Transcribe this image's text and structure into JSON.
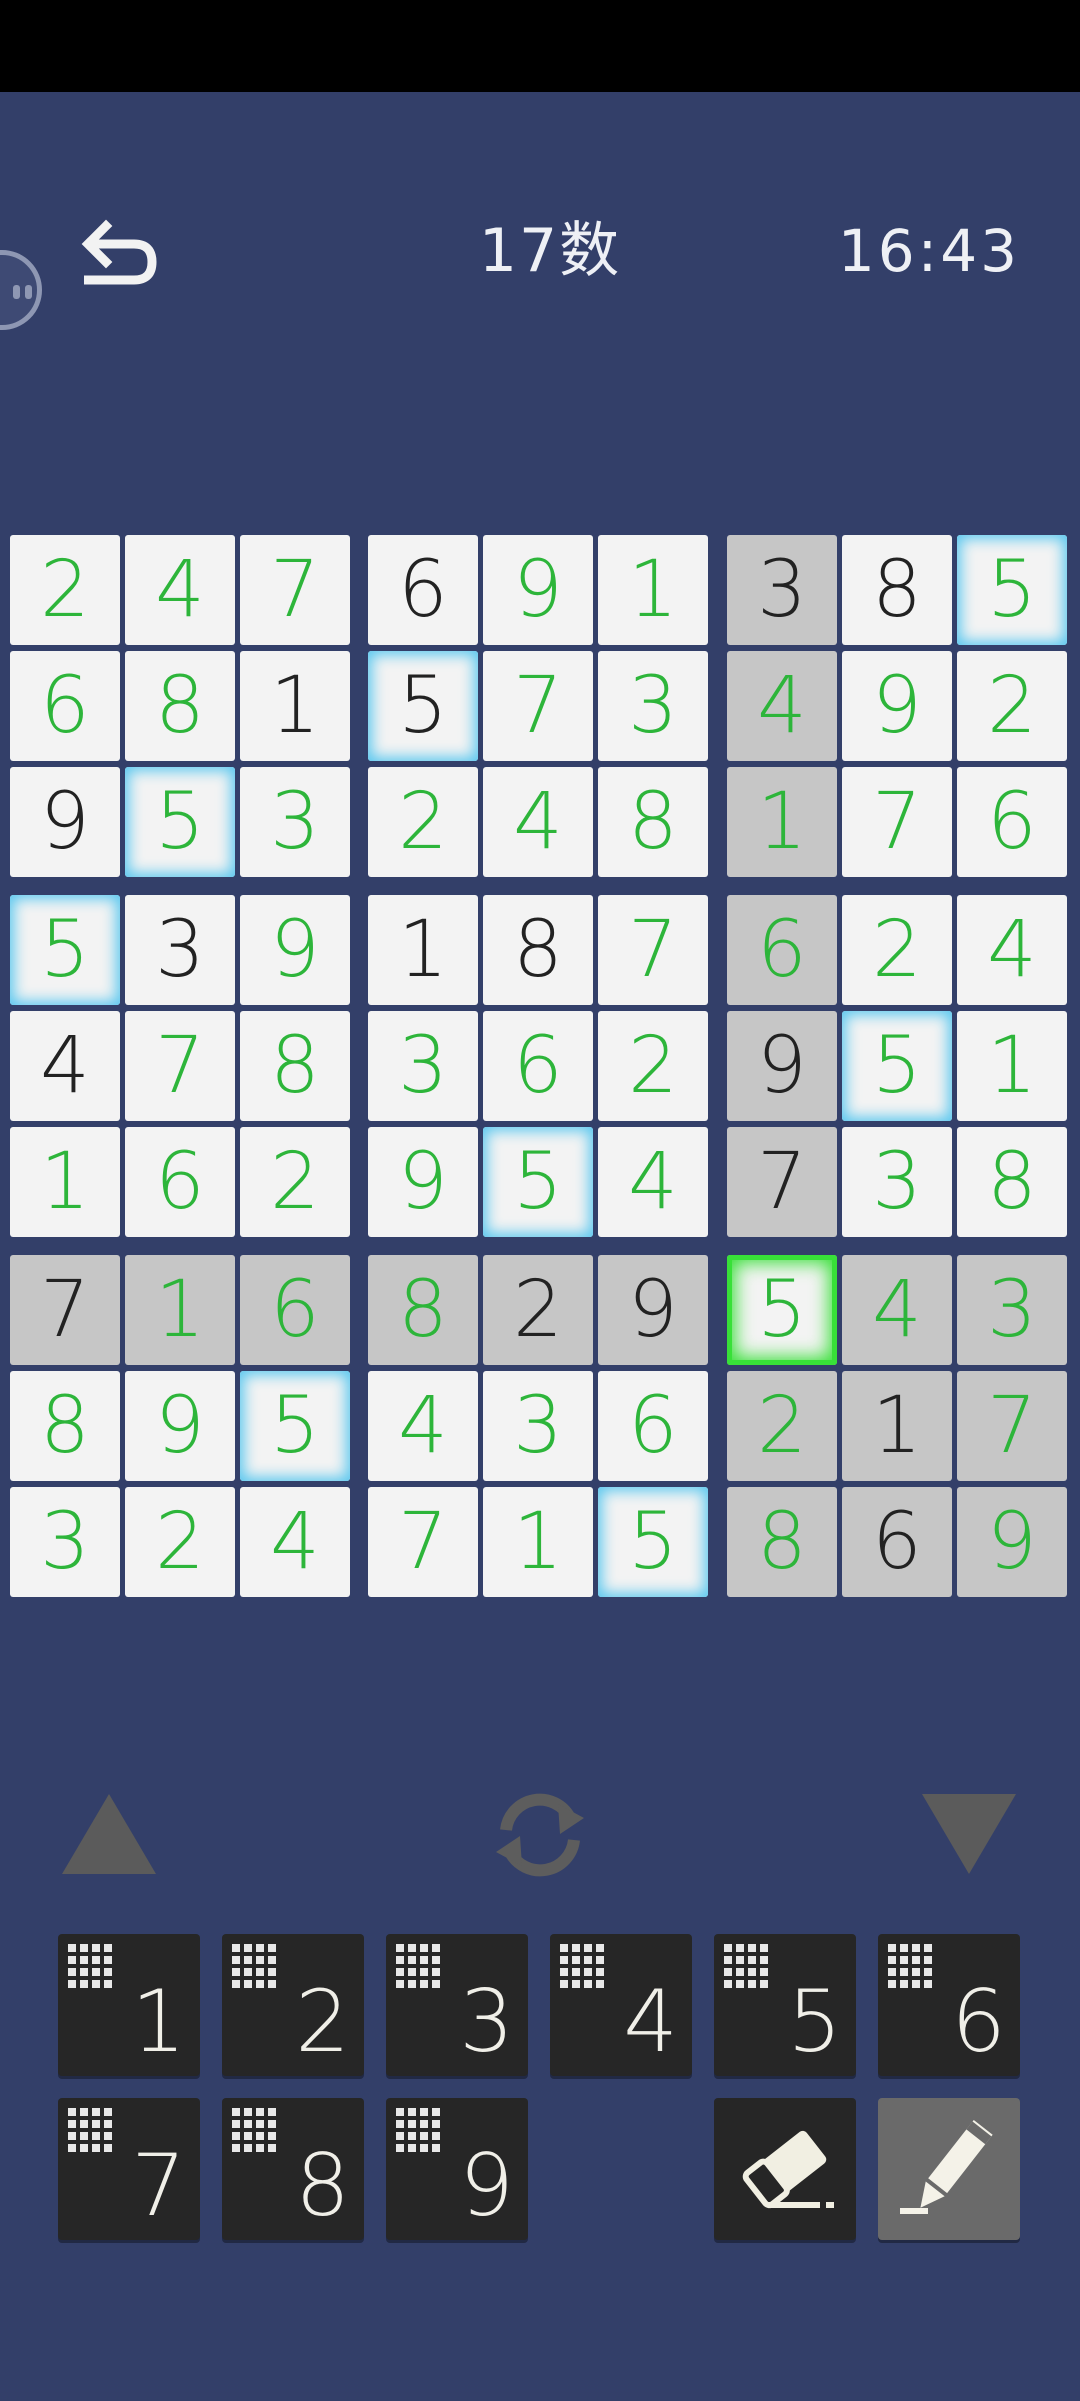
{
  "header": {
    "title": "17数",
    "timer": "16:43"
  },
  "icons": {
    "undo": "undo-arrow-icon",
    "refresh": "refresh-icon",
    "up": "triangle-up-icon",
    "down": "triangle-down-icon",
    "eraser": "eraser-icon",
    "pencil": "pencil-icon",
    "notes": "notes-grid-icon"
  },
  "colors": {
    "background": "#333f69",
    "given_digit": "#222222",
    "entered_digit": "#2db53a",
    "same_number_glow": "#5cc8ef",
    "selected_glow": "#38e038",
    "cell_light": "#f3f3f3",
    "cell_gray": "#c6c6c6"
  },
  "board": {
    "rows": [
      [
        {
          "v": "2",
          "given": false,
          "gray": false,
          "hl": ""
        },
        {
          "v": "4",
          "given": false,
          "gray": false,
          "hl": ""
        },
        {
          "v": "7",
          "given": false,
          "gray": false,
          "hl": ""
        },
        {
          "v": "6",
          "given": true,
          "gray": false,
          "hl": ""
        },
        {
          "v": "9",
          "given": false,
          "gray": false,
          "hl": ""
        },
        {
          "v": "1",
          "given": false,
          "gray": false,
          "hl": ""
        },
        {
          "v": "3",
          "given": true,
          "gray": true,
          "hl": ""
        },
        {
          "v": "8",
          "given": true,
          "gray": false,
          "hl": ""
        },
        {
          "v": "5",
          "given": false,
          "gray": false,
          "hl": "same"
        }
      ],
      [
        {
          "v": "6",
          "given": false,
          "gray": false,
          "hl": ""
        },
        {
          "v": "8",
          "given": false,
          "gray": false,
          "hl": ""
        },
        {
          "v": "1",
          "given": true,
          "gray": false,
          "hl": ""
        },
        {
          "v": "5",
          "given": true,
          "gray": false,
          "hl": "same"
        },
        {
          "v": "7",
          "given": false,
          "gray": false,
          "hl": ""
        },
        {
          "v": "3",
          "given": false,
          "gray": false,
          "hl": ""
        },
        {
          "v": "4",
          "given": false,
          "gray": true,
          "hl": ""
        },
        {
          "v": "9",
          "given": false,
          "gray": false,
          "hl": ""
        },
        {
          "v": "2",
          "given": false,
          "gray": false,
          "hl": ""
        }
      ],
      [
        {
          "v": "9",
          "given": true,
          "gray": false,
          "hl": ""
        },
        {
          "v": "5",
          "given": false,
          "gray": false,
          "hl": "same"
        },
        {
          "v": "3",
          "given": false,
          "gray": false,
          "hl": ""
        },
        {
          "v": "2",
          "given": false,
          "gray": false,
          "hl": ""
        },
        {
          "v": "4",
          "given": false,
          "gray": false,
          "hl": ""
        },
        {
          "v": "8",
          "given": false,
          "gray": false,
          "hl": ""
        },
        {
          "v": "1",
          "given": false,
          "gray": true,
          "hl": ""
        },
        {
          "v": "7",
          "given": false,
          "gray": false,
          "hl": ""
        },
        {
          "v": "6",
          "given": false,
          "gray": false,
          "hl": ""
        }
      ],
      [
        {
          "v": "5",
          "given": false,
          "gray": false,
          "hl": "same"
        },
        {
          "v": "3",
          "given": true,
          "gray": false,
          "hl": ""
        },
        {
          "v": "9",
          "given": false,
          "gray": false,
          "hl": ""
        },
        {
          "v": "1",
          "given": true,
          "gray": false,
          "hl": ""
        },
        {
          "v": "8",
          "given": true,
          "gray": false,
          "hl": ""
        },
        {
          "v": "7",
          "given": false,
          "gray": false,
          "hl": ""
        },
        {
          "v": "6",
          "given": false,
          "gray": true,
          "hl": ""
        },
        {
          "v": "2",
          "given": false,
          "gray": false,
          "hl": ""
        },
        {
          "v": "4",
          "given": false,
          "gray": false,
          "hl": ""
        }
      ],
      [
        {
          "v": "4",
          "given": true,
          "gray": false,
          "hl": ""
        },
        {
          "v": "7",
          "given": false,
          "gray": false,
          "hl": ""
        },
        {
          "v": "8",
          "given": false,
          "gray": false,
          "hl": ""
        },
        {
          "v": "3",
          "given": false,
          "gray": false,
          "hl": ""
        },
        {
          "v": "6",
          "given": false,
          "gray": false,
          "hl": ""
        },
        {
          "v": "2",
          "given": false,
          "gray": false,
          "hl": ""
        },
        {
          "v": "9",
          "given": true,
          "gray": true,
          "hl": ""
        },
        {
          "v": "5",
          "given": false,
          "gray": false,
          "hl": "same"
        },
        {
          "v": "1",
          "given": false,
          "gray": false,
          "hl": ""
        }
      ],
      [
        {
          "v": "1",
          "given": false,
          "gray": false,
          "hl": ""
        },
        {
          "v": "6",
          "given": false,
          "gray": false,
          "hl": ""
        },
        {
          "v": "2",
          "given": false,
          "gray": false,
          "hl": ""
        },
        {
          "v": "9",
          "given": false,
          "gray": false,
          "hl": ""
        },
        {
          "v": "5",
          "given": false,
          "gray": false,
          "hl": "same"
        },
        {
          "v": "4",
          "given": false,
          "gray": false,
          "hl": ""
        },
        {
          "v": "7",
          "given": true,
          "gray": true,
          "hl": ""
        },
        {
          "v": "3",
          "given": false,
          "gray": false,
          "hl": ""
        },
        {
          "v": "8",
          "given": false,
          "gray": false,
          "hl": ""
        }
      ],
      [
        {
          "v": "7",
          "given": true,
          "gray": true,
          "hl": ""
        },
        {
          "v": "1",
          "given": false,
          "gray": true,
          "hl": ""
        },
        {
          "v": "6",
          "given": false,
          "gray": true,
          "hl": ""
        },
        {
          "v": "8",
          "given": false,
          "gray": true,
          "hl": ""
        },
        {
          "v": "2",
          "given": true,
          "gray": true,
          "hl": ""
        },
        {
          "v": "9",
          "given": true,
          "gray": true,
          "hl": ""
        },
        {
          "v": "5",
          "given": false,
          "gray": false,
          "hl": "selected"
        },
        {
          "v": "4",
          "given": false,
          "gray": true,
          "hl": ""
        },
        {
          "v": "3",
          "given": false,
          "gray": true,
          "hl": ""
        }
      ],
      [
        {
          "v": "8",
          "given": false,
          "gray": false,
          "hl": ""
        },
        {
          "v": "9",
          "given": false,
          "gray": false,
          "hl": ""
        },
        {
          "v": "5",
          "given": false,
          "gray": false,
          "hl": "same"
        },
        {
          "v": "4",
          "given": false,
          "gray": false,
          "hl": ""
        },
        {
          "v": "3",
          "given": false,
          "gray": false,
          "hl": ""
        },
        {
          "v": "6",
          "given": false,
          "gray": false,
          "hl": ""
        },
        {
          "v": "2",
          "given": false,
          "gray": true,
          "hl": ""
        },
        {
          "v": "1",
          "given": true,
          "gray": true,
          "hl": ""
        },
        {
          "v": "7",
          "given": false,
          "gray": true,
          "hl": ""
        }
      ],
      [
        {
          "v": "3",
          "given": false,
          "gray": false,
          "hl": ""
        },
        {
          "v": "2",
          "given": false,
          "gray": false,
          "hl": ""
        },
        {
          "v": "4",
          "given": false,
          "gray": false,
          "hl": ""
        },
        {
          "v": "7",
          "given": false,
          "gray": false,
          "hl": ""
        },
        {
          "v": "1",
          "given": false,
          "gray": false,
          "hl": ""
        },
        {
          "v": "5",
          "given": false,
          "gray": false,
          "hl": "same"
        },
        {
          "v": "8",
          "given": false,
          "gray": true,
          "hl": ""
        },
        {
          "v": "6",
          "given": true,
          "gray": true,
          "hl": ""
        },
        {
          "v": "9",
          "given": false,
          "gray": true,
          "hl": ""
        }
      ]
    ]
  },
  "keypad": {
    "numbers": [
      "1",
      "2",
      "3",
      "4",
      "5",
      "6",
      "7",
      "8",
      "9"
    ]
  }
}
